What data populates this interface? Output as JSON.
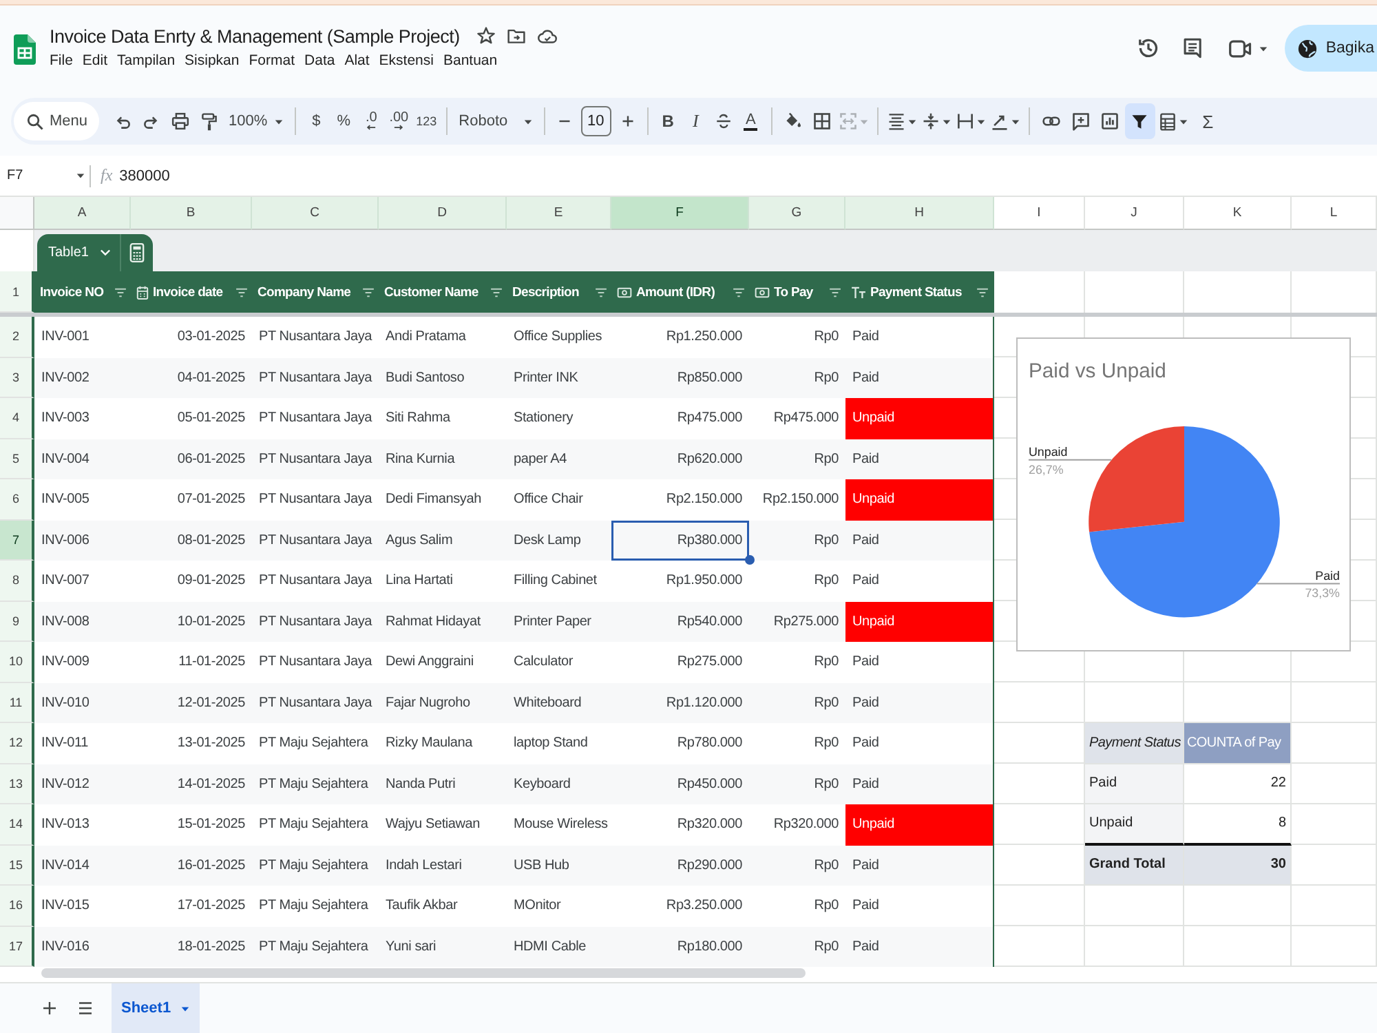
{
  "document": {
    "title": "Invoice Data Enrty & Management (Sample Project)"
  },
  "menu": [
    "File",
    "Edit",
    "Tampilan",
    "Sisipkan",
    "Format",
    "Data",
    "Alat",
    "Ekstensi",
    "Bantuan"
  ],
  "share_button": {
    "label": "Bagika"
  },
  "toolbar": {
    "search_placeholder": "Menu",
    "zoom": "100%",
    "currency": "$",
    "percent": "%",
    "decrease_decimals": ".0",
    "increase_decimals": ".00",
    "number_format": "123",
    "font": "Roboto",
    "font_size": "10",
    "bold": "B",
    "italic": "I",
    "text_color": "A",
    "merge_disabled": true,
    "filter_on": true,
    "functions": "Σ"
  },
  "formula_bar": {
    "cell_ref": "F7",
    "function_label": "fx",
    "value": "380000"
  },
  "column_letters": [
    {
      "label": "A",
      "selected": false,
      "in_table": true
    },
    {
      "label": "B",
      "selected": false,
      "in_table": true
    },
    {
      "label": "C",
      "selected": false,
      "in_table": true
    },
    {
      "label": "D",
      "selected": false,
      "in_table": true
    },
    {
      "label": "E",
      "selected": false,
      "in_table": true
    },
    {
      "label": "F",
      "selected": true,
      "in_table": true
    },
    {
      "label": "G",
      "selected": false,
      "in_table": true
    },
    {
      "label": "H",
      "selected": false,
      "in_table": true
    },
    {
      "label": "I",
      "selected": false,
      "in_table": false
    },
    {
      "label": "J",
      "selected": false,
      "in_table": false
    },
    {
      "label": "K",
      "selected": false,
      "in_table": false
    },
    {
      "label": "L",
      "selected": false,
      "in_table": false
    }
  ],
  "table": {
    "name": "Table1",
    "header_row_number": "1",
    "columns": [
      {
        "label": "Invoice NO",
        "kind": "plain"
      },
      {
        "label": "Invoice date",
        "kind": "date"
      },
      {
        "label": "Company Name",
        "kind": "plain"
      },
      {
        "label": "Customer Name",
        "kind": "plain"
      },
      {
        "label": "Description",
        "kind": "plain"
      },
      {
        "label": "Amount (IDR)",
        "kind": "currency"
      },
      {
        "label": "To Pay",
        "kind": "currency"
      },
      {
        "label": "Payment Status",
        "kind": "text"
      }
    ],
    "rows": [
      {
        "number": "2",
        "selected": false,
        "alert": false,
        "cells": [
          "INV-001",
          "03-01-2025",
          "PT Nusantara Jaya",
          "Andi Pratama",
          "Office Supplies",
          "Rp1.250.000",
          "Rp0",
          "Paid"
        ]
      },
      {
        "number": "3",
        "selected": false,
        "alert": false,
        "cells": [
          "INV-002",
          "04-01-2025",
          "PT Nusantara Jaya",
          "Budi Santoso",
          "Printer INK",
          "Rp850.000",
          "Rp0",
          "Paid"
        ]
      },
      {
        "number": "4",
        "selected": false,
        "alert": true,
        "cells": [
          "INV-003",
          "05-01-2025",
          "PT Nusantara Jaya",
          "Siti Rahma",
          "Stationery",
          "Rp475.000",
          "Rp475.000",
          "Unpaid"
        ]
      },
      {
        "number": "5",
        "selected": false,
        "alert": false,
        "cells": [
          "INV-004",
          "06-01-2025",
          "PT Nusantara Jaya",
          "Rina Kurnia",
          "paper A4",
          "Rp620.000",
          "Rp0",
          "Paid"
        ]
      },
      {
        "number": "6",
        "selected": false,
        "alert": true,
        "cells": [
          "INV-005",
          "07-01-2025",
          "PT Nusantara Jaya",
          "Dedi Fimansyah",
          "Office Chair",
          "Rp2.150.000",
          "Rp2.150.000",
          "Unpaid"
        ]
      },
      {
        "number": "7",
        "selected": true,
        "alert": false,
        "cells": [
          "INV-006",
          "08-01-2025",
          "PT Nusantara Jaya",
          "Agus Salim",
          "Desk Lamp",
          "Rp380.000",
          "Rp0",
          "Paid"
        ]
      },
      {
        "number": "8",
        "selected": false,
        "alert": false,
        "cells": [
          "INV-007",
          "09-01-2025",
          "PT Nusantara Jaya",
          "Lina Hartati",
          "Filling Cabinet",
          "Rp1.950.000",
          "Rp0",
          "Paid"
        ]
      },
      {
        "number": "9",
        "selected": false,
        "alert": true,
        "cells": [
          "INV-008",
          "10-01-2025",
          "PT Nusantara Jaya",
          "Rahmat Hidayat",
          "Printer Paper",
          "Rp540.000",
          "Rp275.000",
          "Unpaid"
        ]
      },
      {
        "number": "10",
        "selected": false,
        "alert": false,
        "cells": [
          "INV-009",
          "11-01-2025",
          "PT Nusantara Jaya",
          "Dewi Anggraini",
          "Calculator",
          "Rp275.000",
          "Rp0",
          "Paid"
        ]
      },
      {
        "number": "11",
        "selected": false,
        "alert": false,
        "cells": [
          "INV-010",
          "12-01-2025",
          "PT Nusantara Jaya",
          "Fajar Nugroho",
          "Whiteboard",
          "Rp1.120.000",
          "Rp0",
          "Paid"
        ]
      },
      {
        "number": "12",
        "selected": false,
        "alert": false,
        "cells": [
          "INV-011",
          "13-01-2025",
          "PT Maju Sejahtera",
          "Rizky Maulana",
          "laptop Stand",
          "Rp780.000",
          "Rp0",
          "Paid"
        ]
      },
      {
        "number": "13",
        "selected": false,
        "alert": false,
        "cells": [
          "INV-012",
          "14-01-2025",
          "PT Maju Sejahtera",
          "Nanda Putri",
          "Keyboard",
          "Rp450.000",
          "Rp0",
          "Paid"
        ]
      },
      {
        "number": "14",
        "selected": false,
        "alert": true,
        "cells": [
          "INV-013",
          "15-01-2025",
          "PT Maju Sejahtera",
          "Wajyu Setiawan",
          "Mouse Wireless",
          "Rp320.000",
          "Rp320.000",
          "Unpaid"
        ]
      },
      {
        "number": "15",
        "selected": false,
        "alert": false,
        "cells": [
          "INV-014",
          "16-01-2025",
          "PT Maju Sejahtera",
          "Indah Lestari",
          "USB Hub",
          "Rp290.000",
          "Rp0",
          "Paid"
        ]
      },
      {
        "number": "16",
        "selected": false,
        "alert": false,
        "cells": [
          "INV-015",
          "17-01-2025",
          "PT Maju Sejahtera",
          "Taufik Akbar",
          "MOnitor",
          "Rp3.250.000",
          "Rp0",
          "Paid"
        ]
      },
      {
        "number": "17",
        "selected": false,
        "alert": false,
        "cells": [
          "INV-016",
          "18-01-2025",
          "PT Maju Sejahtera",
          "Yuni sari",
          "HDMI Cable",
          "Rp180.000",
          "Rp0",
          "Paid"
        ]
      }
    ]
  },
  "chart": {
    "chart_data": [
      {
        "type": "pie",
        "title": "Paid vs Unpaid",
        "categories": [
          "Paid",
          "Unpaid"
        ],
        "values": [
          73.3,
          26.7
        ],
        "colors": [
          "#4285f4",
          "#ea4335"
        ],
        "value_labels": [
          "73,3%",
          "26,7%"
        ]
      }
    ]
  },
  "pivot": {
    "headers": [
      "Payment Status",
      "COUNTA of Pay"
    ],
    "rows": [
      {
        "label": "Paid",
        "value": "22"
      },
      {
        "label": "Unpaid",
        "value": "8"
      }
    ],
    "total": {
      "label": "Grand Total",
      "value": "30"
    }
  },
  "sheet_tabs": [
    {
      "label": "Sheet1",
      "selected": true
    }
  ]
}
